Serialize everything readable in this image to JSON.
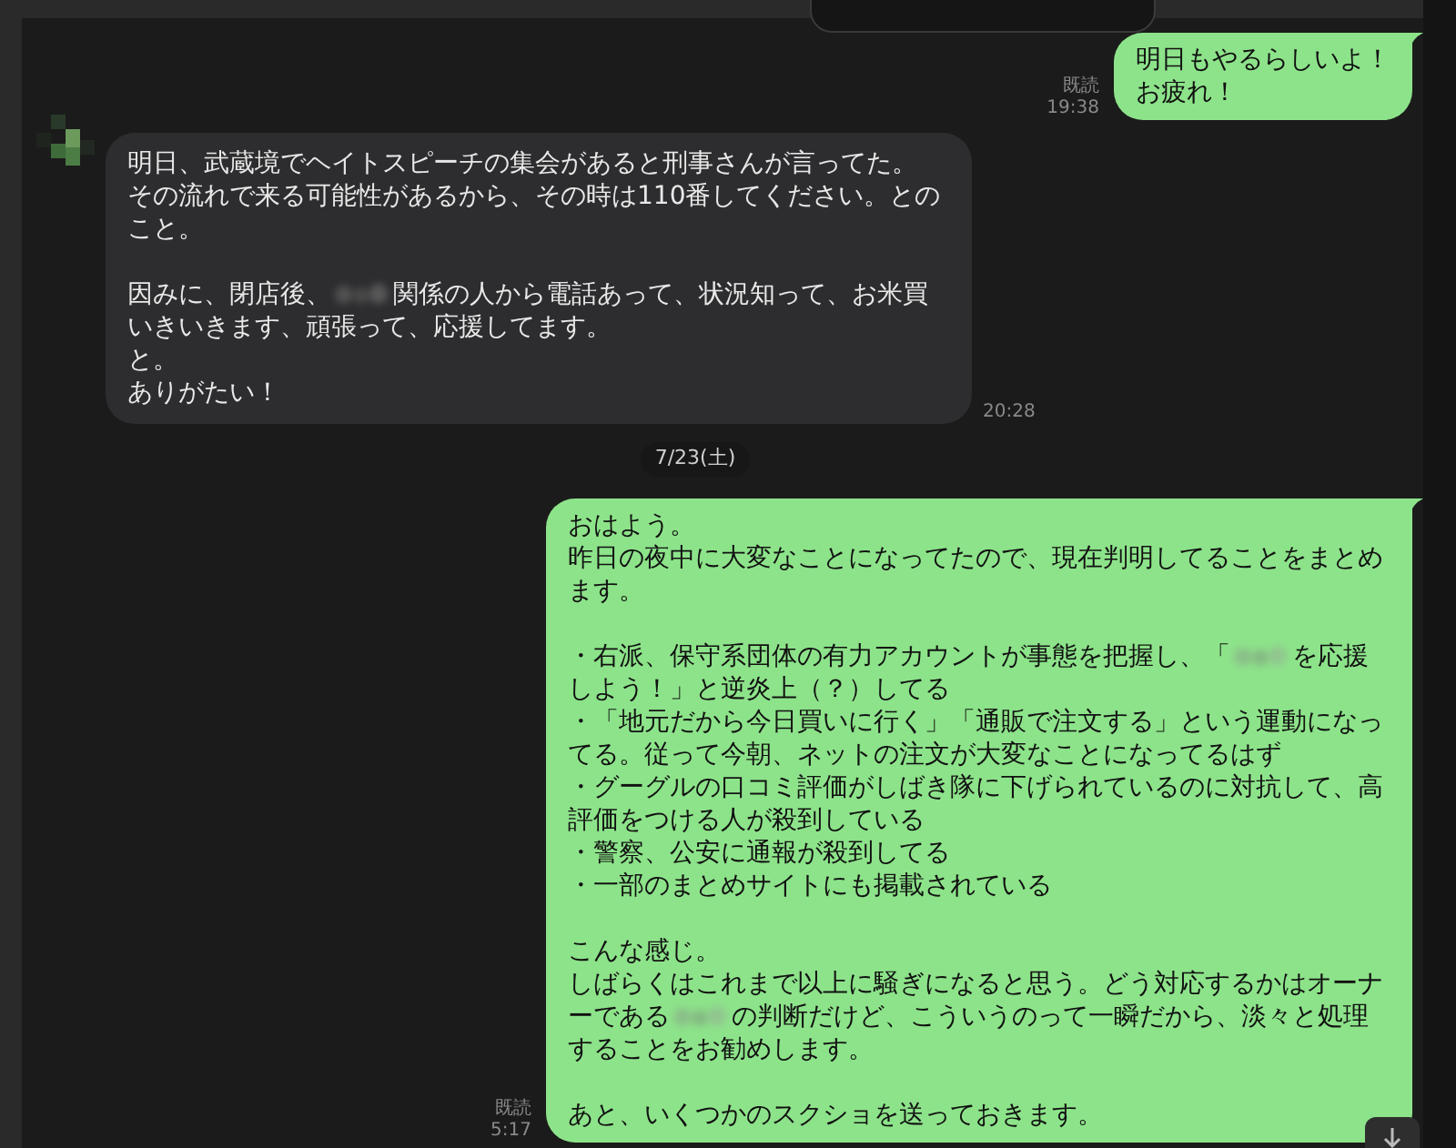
{
  "timeline": [
    {
      "kind": "sent",
      "paragraphs": [
        [
          [
            {
              "kind": "text",
              "text": "明日もやるらしいよ！"
            }
          ],
          [
            {
              "kind": "text",
              "text": "お疲れ！"
            }
          ]
        ]
      ],
      "read_label": "既読",
      "time": "19:38"
    },
    {
      "kind": "received",
      "paragraphs": [
        [
          [
            {
              "kind": "text",
              "text": "明日、武蔵境でヘイトスピーチの集会があると刑事さんが言ってた。"
            }
          ],
          [
            {
              "kind": "text",
              "text": "その流れで来る可能性があるから、その時は110番してください。とのこと。"
            }
          ]
        ],
        [
          [
            {
              "kind": "text",
              "text": "因みに、閉店後、"
            },
            {
              "kind": "redacted"
            },
            {
              "kind": "text",
              "text": "関係の人から電話あって、状況知って、お米買いきいきます、頑張って、応援してます。"
            }
          ],
          [
            {
              "kind": "text",
              "text": "と。"
            }
          ],
          [
            {
              "kind": "text",
              "text": "ありがたい！"
            }
          ]
        ]
      ],
      "time": "20:28"
    },
    {
      "kind": "date",
      "label": "7/23(土)"
    },
    {
      "kind": "sent",
      "paragraphs": [
        [
          [
            {
              "kind": "text",
              "text": "おはよう。"
            }
          ],
          [
            {
              "kind": "text",
              "text": "昨日の夜中に大変なことになってたので、現在判明してることをまとめます。"
            }
          ]
        ],
        [
          [
            {
              "kind": "text",
              "text": "・右派、保守系団体の有力アカウントが事態を把握し、「"
            },
            {
              "kind": "redacted"
            },
            {
              "kind": "text",
              "text": "を応援しよう！」と逆炎上（？）してる"
            }
          ],
          [
            {
              "kind": "text",
              "text": "・「地元だから今日買いに行く」「通販で注文する」という運動になってる。従って今朝、ネットの注文が大変なことになってるはず"
            }
          ],
          [
            {
              "kind": "text",
              "text": "・グーグルの口コミ評価がしばき隊に下げられているのに対抗して、高評価をつける人が殺到している"
            }
          ],
          [
            {
              "kind": "text",
              "text": "・警察、公安に通報が殺到してる"
            }
          ],
          [
            {
              "kind": "text",
              "text": "・一部のまとめサイトにも掲載されている"
            }
          ]
        ],
        [
          [
            {
              "kind": "text",
              "text": "こんな感じ。"
            }
          ],
          [
            {
              "kind": "text",
              "text": "しばらくはこれまで以上に騒ぎになると思う。どう対応するかはオーナーである"
            },
            {
              "kind": "redacted"
            },
            {
              "kind": "text",
              "text": "の判断だけど、こういうのって一瞬だから、淡々と処理することをお勧めします。"
            }
          ]
        ],
        [
          [
            {
              "kind": "text",
              "text": "あと、いくつかのスクショを送っておきます。"
            }
          ]
        ]
      ],
      "read_label": "既読",
      "time": "5:17"
    }
  ]
}
